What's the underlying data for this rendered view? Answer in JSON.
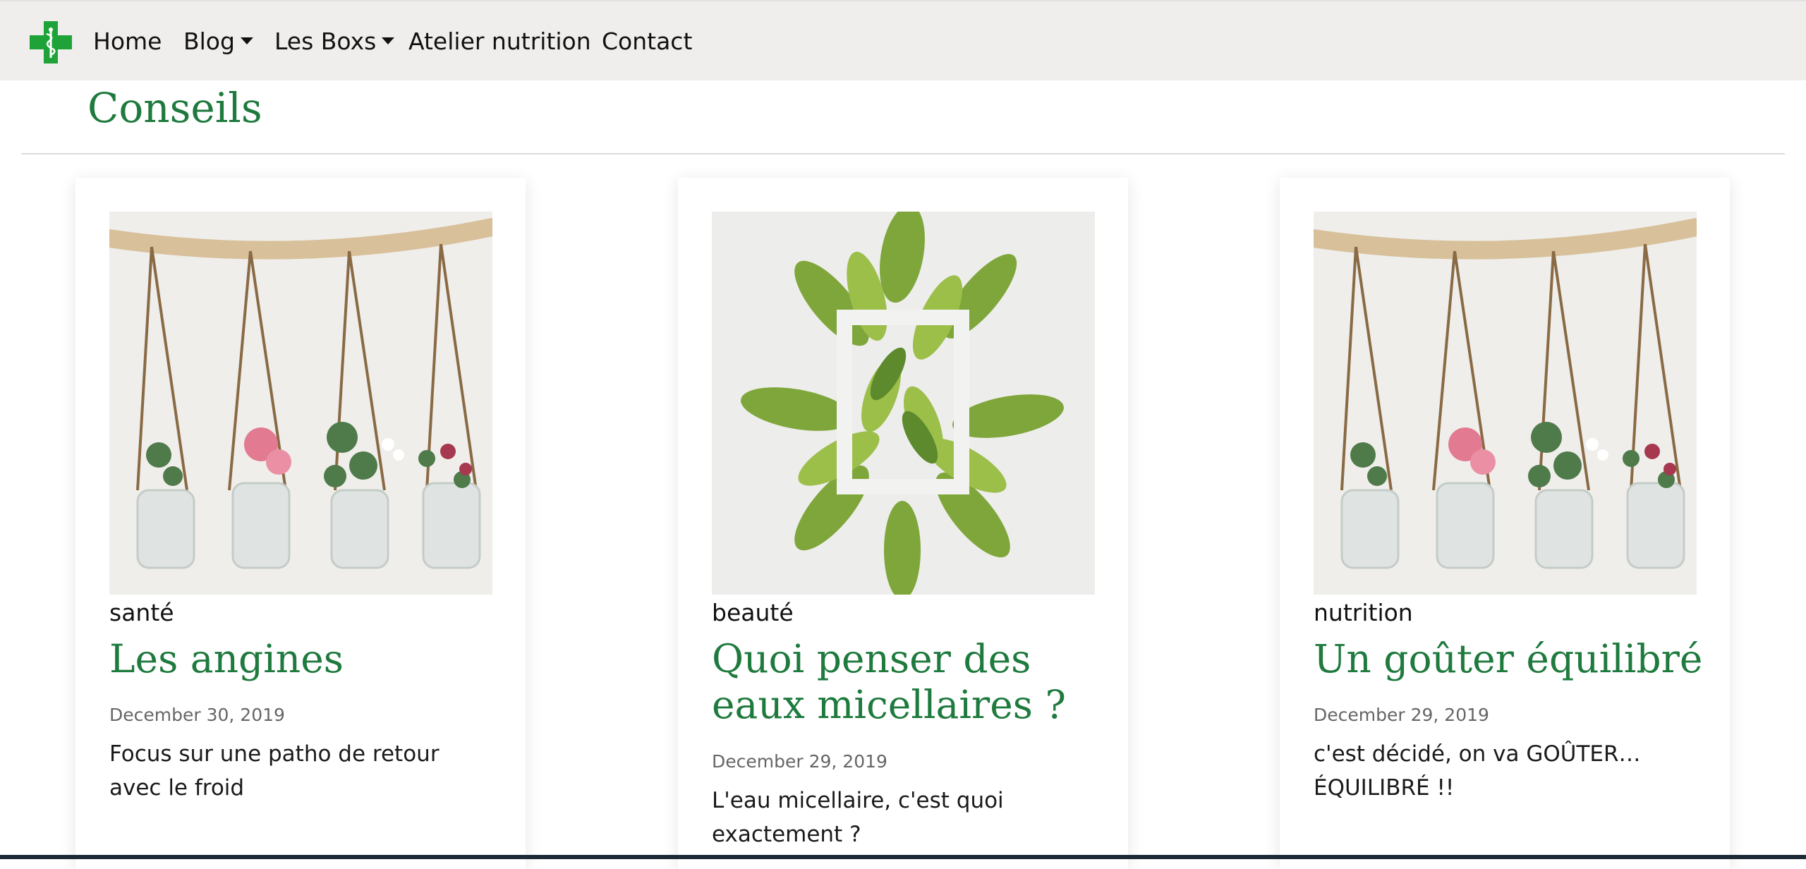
{
  "nav": {
    "logo_icon": "pharmacy-cross-icon",
    "home": "Home",
    "blog": "Blog",
    "boxes": "Les Boxs",
    "atelier": "Atelier nutrition",
    "contact": "Contact"
  },
  "page": {
    "title": "Conseils"
  },
  "cards": [
    {
      "category": "santé",
      "title": "Les angines",
      "date": "December 30, 2019",
      "excerpt": "Focus sur une patho de retour avec le froid",
      "image": "hanging-flower-jars-image"
    },
    {
      "category": "beauté",
      "title": "Quoi penser des eaux micellaires ?",
      "date": "December 29, 2019",
      "excerpt": "L'eau micellaire, c'est quoi exactement ?",
      "image": "leaves-frame-image"
    },
    {
      "category": "nutrition",
      "title": "Un goûter équilibré",
      "date": "December 29, 2019",
      "excerpt": "c'est décidé, on va GOÛTER… ÉQUILIBRÉ !!",
      "image": "hanging-flower-jars-image"
    }
  ],
  "colors": {
    "brand_green": "#1f7a3e",
    "logo_green": "#1fa339",
    "navbar_bg": "#efeeec"
  }
}
